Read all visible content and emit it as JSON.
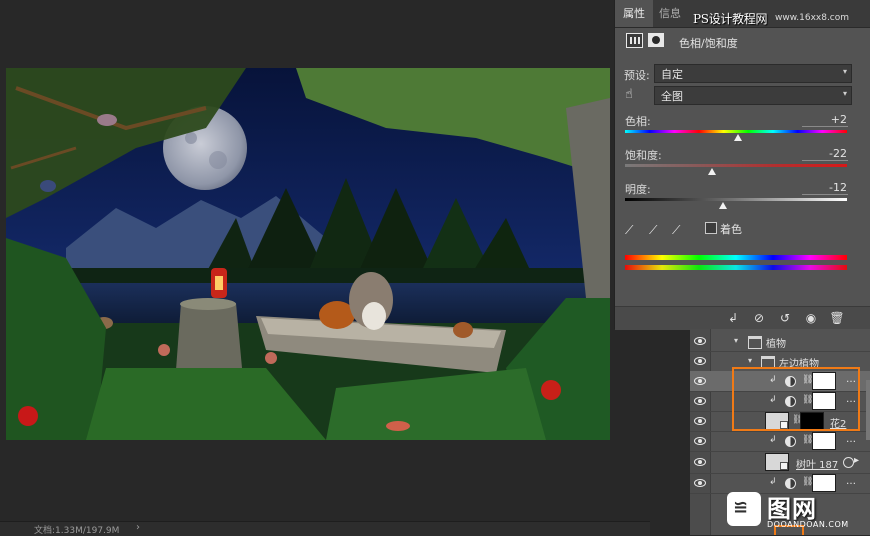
{
  "status": {
    "doc_label": "文档:1.33M/197.9M",
    "arrow": "›"
  },
  "props_panel": {
    "tabs": [
      "属性",
      "信息"
    ],
    "watermark": "PS设计教程网",
    "watermark_url": "www.16xx8.com",
    "adjustment_title": "色相/饱和度",
    "preset_label": "预设:",
    "preset_value": "自定",
    "channel_value": "全图",
    "sliders": [
      {
        "label": "色相:",
        "value": "+2",
        "position": 0.51
      },
      {
        "label": "饱和度:",
        "value": "-22",
        "position": 0.39
      },
      {
        "label": "明度:",
        "value": "-12",
        "position": 0.44
      }
    ],
    "colorize_label": "着色",
    "footer_icons": [
      "clip-to-layer-icon",
      "view-previous-icon",
      "reset-icon",
      "visibility-icon",
      "trash-icon"
    ]
  },
  "layers_panel": {
    "rows": [
      {
        "type": "folder",
        "name": "植物",
        "indent": 0
      },
      {
        "type": "folder",
        "name": "左边植物",
        "indent": 1
      },
      {
        "type": "adjustment",
        "name": "",
        "selected": true
      },
      {
        "type": "adjustment",
        "name": ""
      },
      {
        "type": "image",
        "name": "花2",
        "mask": "black"
      },
      {
        "type": "adjustment",
        "name": ""
      },
      {
        "type": "image",
        "name": "树叶 187"
      },
      {
        "type": "adjustment",
        "name": ""
      }
    ]
  },
  "logo": {
    "cn": "图网",
    "badge": "≌",
    "en": "DOOANDOAN.COM"
  }
}
